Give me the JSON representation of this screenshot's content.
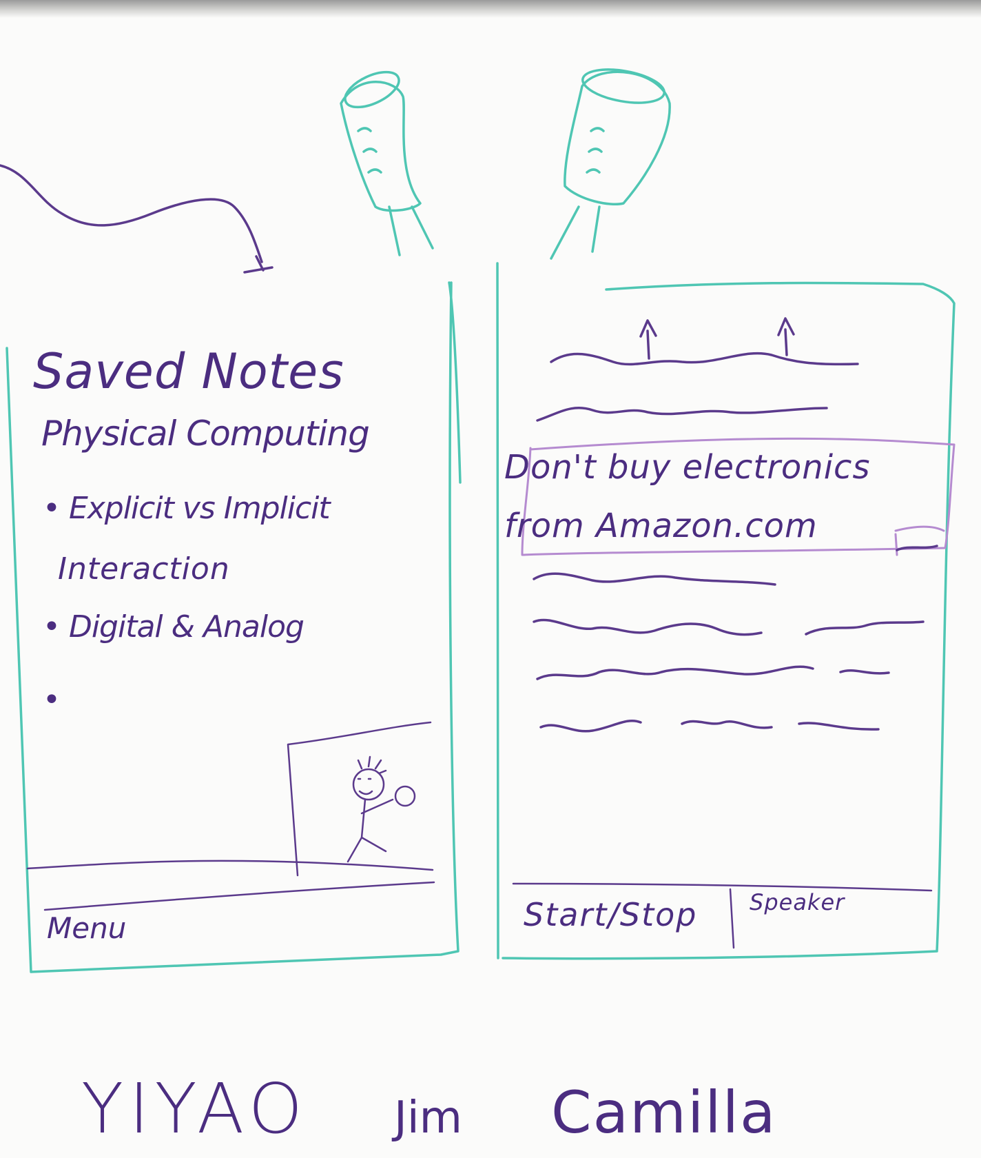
{
  "left_screen": {
    "title": "Saved Notes",
    "subtitle": "Physical Computing",
    "bullets": [
      "• Explicit vs Implicit",
      "Interaction",
      "• Digital & Analog",
      "•"
    ],
    "footer_label": "Menu"
  },
  "right_screen": {
    "highlight_lines": [
      "Don't buy electronics",
      "from Amazon.com"
    ],
    "buttons": {
      "start_stop": "Start/Stop",
      "speaker": "Speaker"
    }
  },
  "names": [
    "YIYAO",
    "Jim",
    "Camilla"
  ],
  "colors": {
    "ink": "#5b3a8c",
    "teal": "#4fc6b3",
    "highlight": "#b58bd0"
  }
}
